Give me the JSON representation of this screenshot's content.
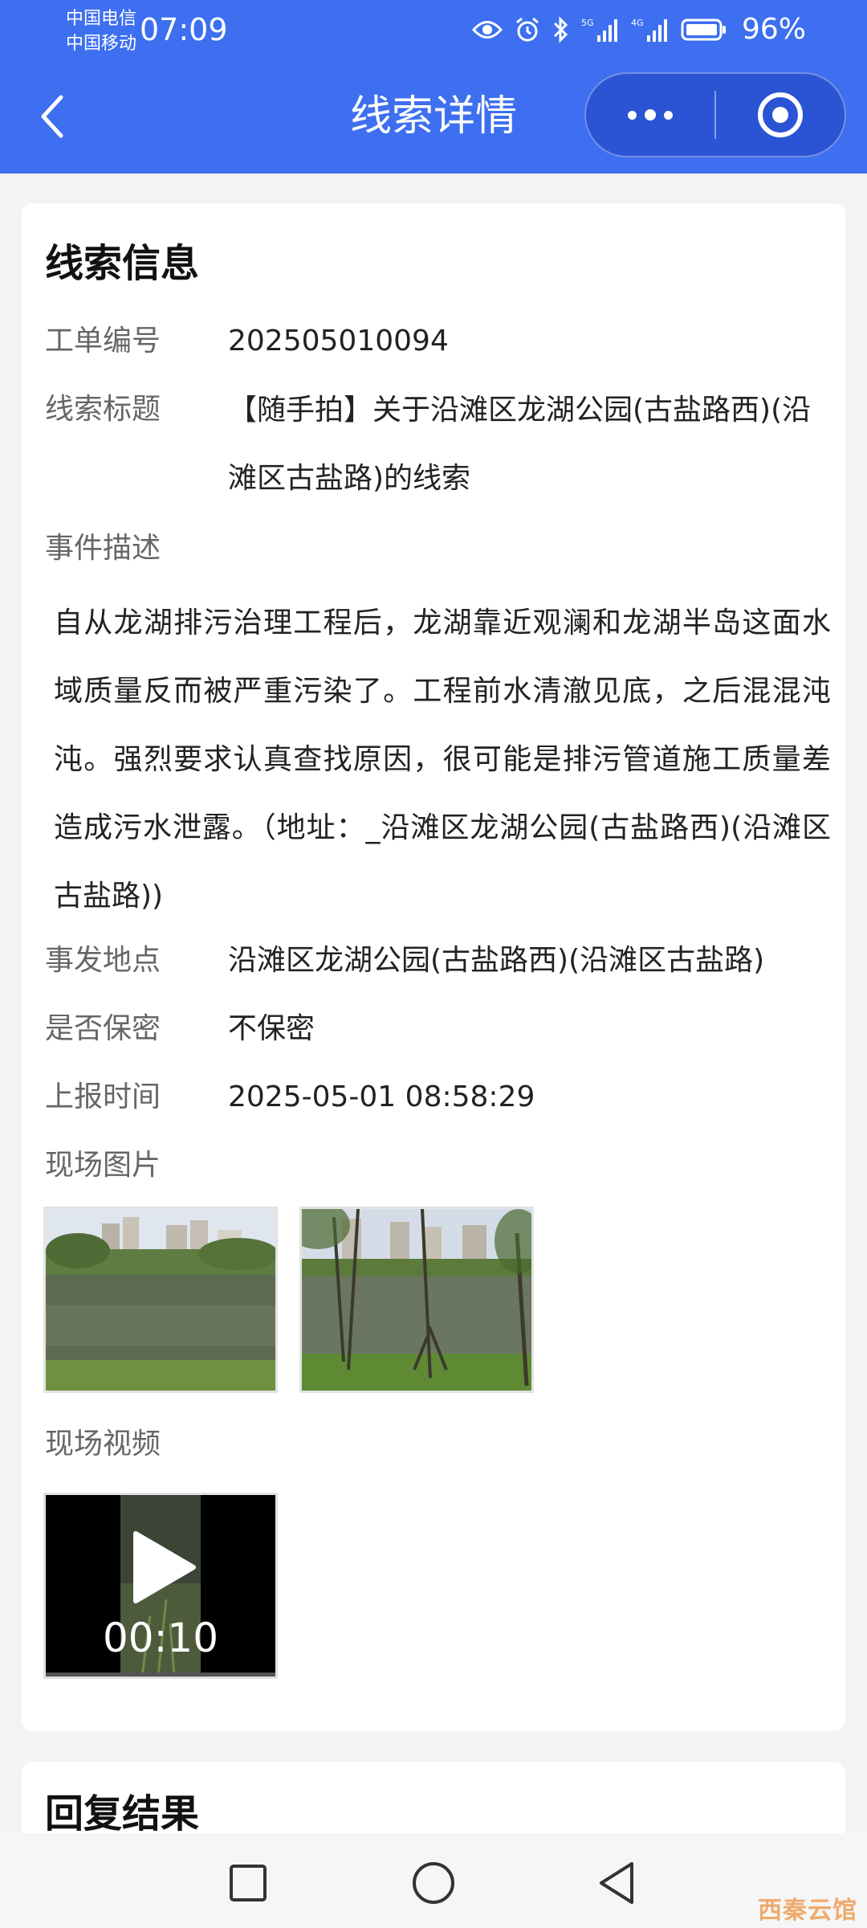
{
  "status_bar": {
    "carrier_1": "中国电信",
    "carrier_2": "中国移动",
    "time": "07:09",
    "battery": "96%"
  },
  "nav": {
    "title": "线索详情"
  },
  "clue_info": {
    "section_title": "线索信息",
    "order_no_label": "工单编号",
    "order_no": "202505010094",
    "title_label": "线索标题",
    "title_value": "【随手拍】关于沿滩区龙湖公园(古盐路西)(沿滩区古盐路)的线索",
    "desc_label": "事件描述",
    "description": "自从龙湖排污治理工程后，龙湖靠近观澜和龙湖半岛这面水域质量反而被严重污染了。工程前水清澈见底，之后混混沌沌。强烈要求认真查找原因，很可能是排污管道施工质量差造成污水泄露。（地址：_沿滩区龙湖公园(古盐路西)(沿滩区古盐路))",
    "location_label": "事发地点",
    "location": "沿滩区龙湖公园(古盐路西)(沿滩区古盐路)",
    "confidential_label": "是否保密",
    "confidential": "不保密",
    "report_time_label": "上报时间",
    "report_time": "2025-05-01 08:58:29",
    "photos_label": "现场图片",
    "video_label": "现场视频",
    "video_duration": "00:10"
  },
  "reply": {
    "section_title": "回复结果"
  },
  "watermark": "西秦云馆",
  "colors": {
    "header_bg": "#3d6ff0",
    "page_bg": "#f2f3f5",
    "card_bg": "#ffffff"
  }
}
